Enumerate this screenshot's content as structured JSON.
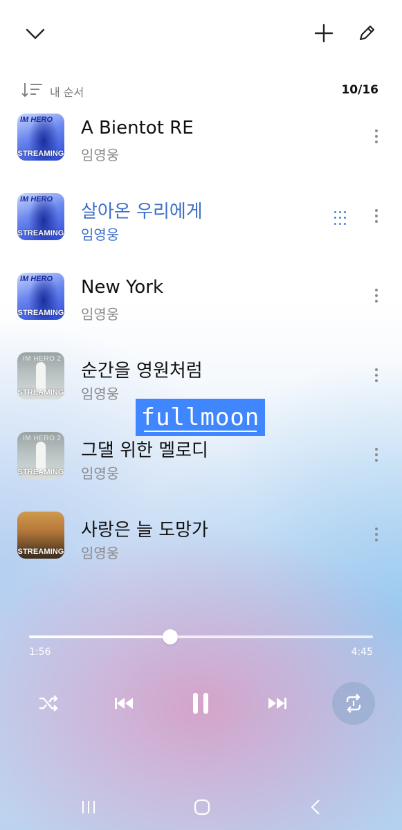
{
  "header": {
    "collapse_icon": "chevron-down-icon",
    "add_icon": "plus-icon",
    "edit_icon": "pencil-icon"
  },
  "sort": {
    "label": "내 순서",
    "counter": "10/16"
  },
  "tracks": [
    {
      "title": "A Bientot RE",
      "artist": "임영웅",
      "badge": "STREAMING",
      "cover_logo": "IM HERO"
    },
    {
      "title": "살아온 우리에게",
      "artist": "임영웅",
      "badge": "STREAMING",
      "cover_logo": "IM HERO",
      "active": true
    },
    {
      "title": "New York",
      "artist": "임영웅",
      "badge": "STREAMING",
      "cover_logo": "IM HERO"
    },
    {
      "title": "순간을 영원처럼",
      "artist": "임영웅",
      "badge": "STREAMING",
      "cover_logo": "IM HERO 2"
    },
    {
      "title": "그댈 위한 멜로디",
      "artist": "임영웅",
      "badge": "STREAMING",
      "cover_logo": "IM HERO 2"
    },
    {
      "title": "사랑은 늘 도망가",
      "artist": "임영웅",
      "badge": "STREAMING",
      "cover_logo": ""
    }
  ],
  "sticker": {
    "text": "fullmoon"
  },
  "player": {
    "elapsed": "1:56",
    "duration": "4:45",
    "progress": 0.41
  },
  "colors": {
    "active": "#3e6fc7",
    "sticker": "#3f86ff"
  }
}
